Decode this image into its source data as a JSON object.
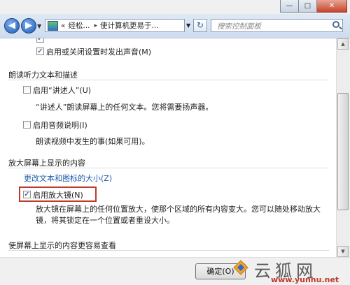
{
  "window": {
    "minimize_glyph": "—",
    "maximize_glyph": "□",
    "close_glyph": "✕"
  },
  "nav": {
    "back_glyph": "◀",
    "forward_glyph": "▶",
    "dropdown_glyph": "▼",
    "breadcrumb_sep": "«",
    "crumb1": "经松...",
    "crumb_arrow": "▸",
    "crumb2": "使计算机更易于...",
    "refresh_glyph": "↻",
    "search_placeholder": "搜索控制面板"
  },
  "content": {
    "top_row1_label": "启用或关闭设置时发出声音(M)",
    "section1": "朗读听力文本和描述",
    "narrator_label": "启用“讲述人”(U)",
    "narrator_desc": "“讲述人”朗读屏幕上的任何文本。您将需要扬声器。",
    "audio_desc_label": "启用音频说明(I)",
    "audio_desc_desc": "朗读视频中发生的事(如果可用)。",
    "section2": "放大屏幕上显示的内容",
    "text_size_link": "更改文本和图标的大小(Z)",
    "magnifier_label": "启用放大镜(N)",
    "magnifier_desc": "放大镜在屏幕上的任何位置放大，使那个区域的所有内容变大。您可以随处移动放大镜，将其锁定在一个位置或者重设大小。",
    "section3": "使屏幕上显示的内容更容易查看"
  },
  "checks": {
    "top_row0": true,
    "top_row1": true,
    "narrator": false,
    "audio_desc": false,
    "magnifier": true
  },
  "footer": {
    "ok_label": "确定(O)"
  },
  "watermark": {
    "url": "www.yunhu.net",
    "chars": "云狐网"
  },
  "colors": {
    "highlight_box": "#c0392b",
    "link": "#1e5aa8"
  }
}
